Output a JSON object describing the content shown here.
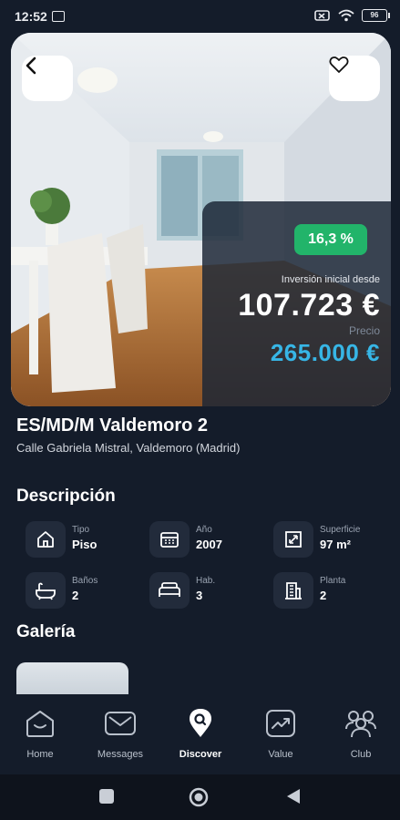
{
  "status_bar": {
    "time": "12:52",
    "battery": "96"
  },
  "hero": {
    "icons": {
      "back": "chevron-left-icon",
      "favorite": "heart-icon"
    },
    "badge": "16,3 %",
    "investment_label": "Inversión inicial desde",
    "investment_value": "107.723 €",
    "price_label": "Precio",
    "price_value": "265.000 €",
    "colors": {
      "badge": "#22b46a",
      "price": "#37b6e6"
    }
  },
  "property": {
    "title": "ES/MD/M Valdemoro  2",
    "address": "Calle Gabriela Mistral, Valdemoro (Madrid)"
  },
  "description": {
    "title": "Descripción",
    "features": [
      {
        "icon": "house-icon",
        "label": "Tipo",
        "value": "Piso"
      },
      {
        "icon": "calendar-icon",
        "label": "Año",
        "value": "2007"
      },
      {
        "icon": "area-icon",
        "label": "Superficie",
        "value": "97 m²"
      },
      {
        "icon": "bathtub-icon",
        "label": "Baños",
        "value": "2"
      },
      {
        "icon": "bed-icon",
        "label": "Hab.",
        "value": "3"
      },
      {
        "icon": "building-icon",
        "label": "Planta",
        "value": "2"
      }
    ]
  },
  "gallery": {
    "title": "Galería"
  },
  "bottom_nav": {
    "items": [
      {
        "icon": "home-icon",
        "label": "Home"
      },
      {
        "icon": "messages-icon",
        "label": "Messages"
      },
      {
        "icon": "discover-icon",
        "label": "Discover",
        "active": true
      },
      {
        "icon": "value-icon",
        "label": "Value"
      },
      {
        "icon": "club-icon",
        "label": "Club"
      }
    ]
  }
}
